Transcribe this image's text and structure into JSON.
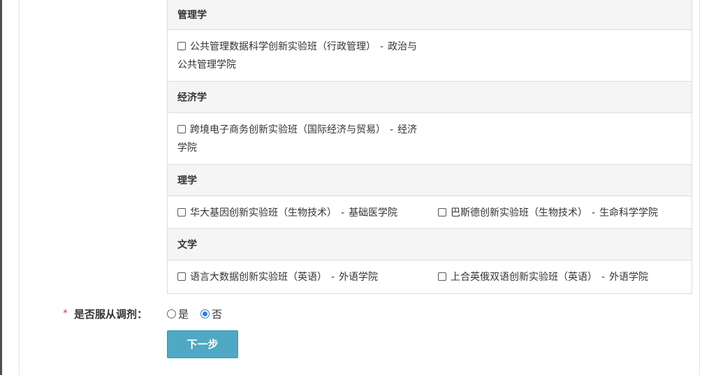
{
  "categories": [
    {
      "name": "管理学",
      "options": [
        {
          "label": "公共管理数据科学创新实验班（行政管理）",
          "sep": "-",
          "college": "政治与公共管理学院",
          "checked": false
        }
      ]
    },
    {
      "name": "经济学",
      "options": [
        {
          "label": "跨境电子商务创新实验班（国际经济与贸易）",
          "sep": "-",
          "college": "经济学院",
          "checked": false
        }
      ]
    },
    {
      "name": "理学",
      "options": [
        {
          "label": "华大基因创新实验班（生物技术）",
          "sep": "-",
          "college": "基础医学院",
          "checked": false
        },
        {
          "label": "巴斯德创新实验班（生物技术）",
          "sep": "-",
          "college": "生命科学学院",
          "checked": false
        }
      ]
    },
    {
      "name": "文学",
      "options": [
        {
          "label": "语言大数据创新实验班（英语）",
          "sep": "-",
          "college": "外语学院",
          "checked": false
        },
        {
          "label": "上合英俄双语创新实验班（英语）",
          "sep": "-",
          "college": "外语学院",
          "checked": false
        }
      ]
    }
  ],
  "follow": {
    "required_mark": "*",
    "label": "是否服从调剂：",
    "options": [
      {
        "label": "是",
        "checked": false
      },
      {
        "label": "否",
        "checked": true
      }
    ]
  },
  "next_button": {
    "label": "下一步"
  },
  "colors": {
    "accent": "#4fa8c4",
    "radio_checked": "#2a7de1",
    "required": "#ee3333"
  }
}
